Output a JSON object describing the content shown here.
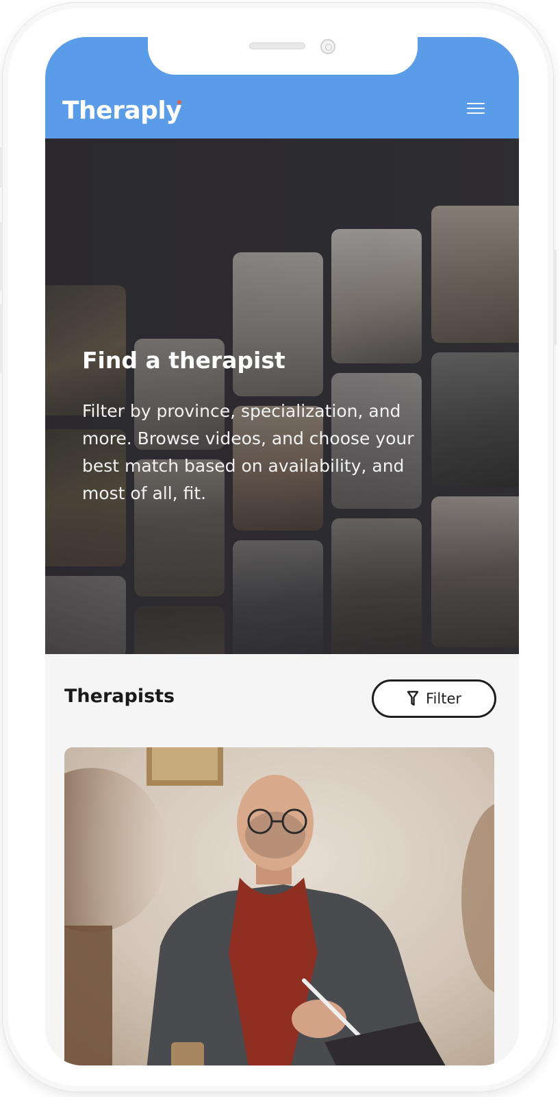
{
  "header": {
    "logo_text": "Theraply",
    "brand_color": "#5b9ce8",
    "logo_accent_color": "#e0614c",
    "menu_icon": "hamburger-menu-icon"
  },
  "hero": {
    "title": "Find a therapist",
    "description": "Filter by province, specialization, and more. Browse videos, and choose your best match based on availability, and most of all, fit."
  },
  "therapists": {
    "section_title": "Therapists",
    "filter_label": "Filter",
    "filter_icon": "funnel-icon"
  }
}
